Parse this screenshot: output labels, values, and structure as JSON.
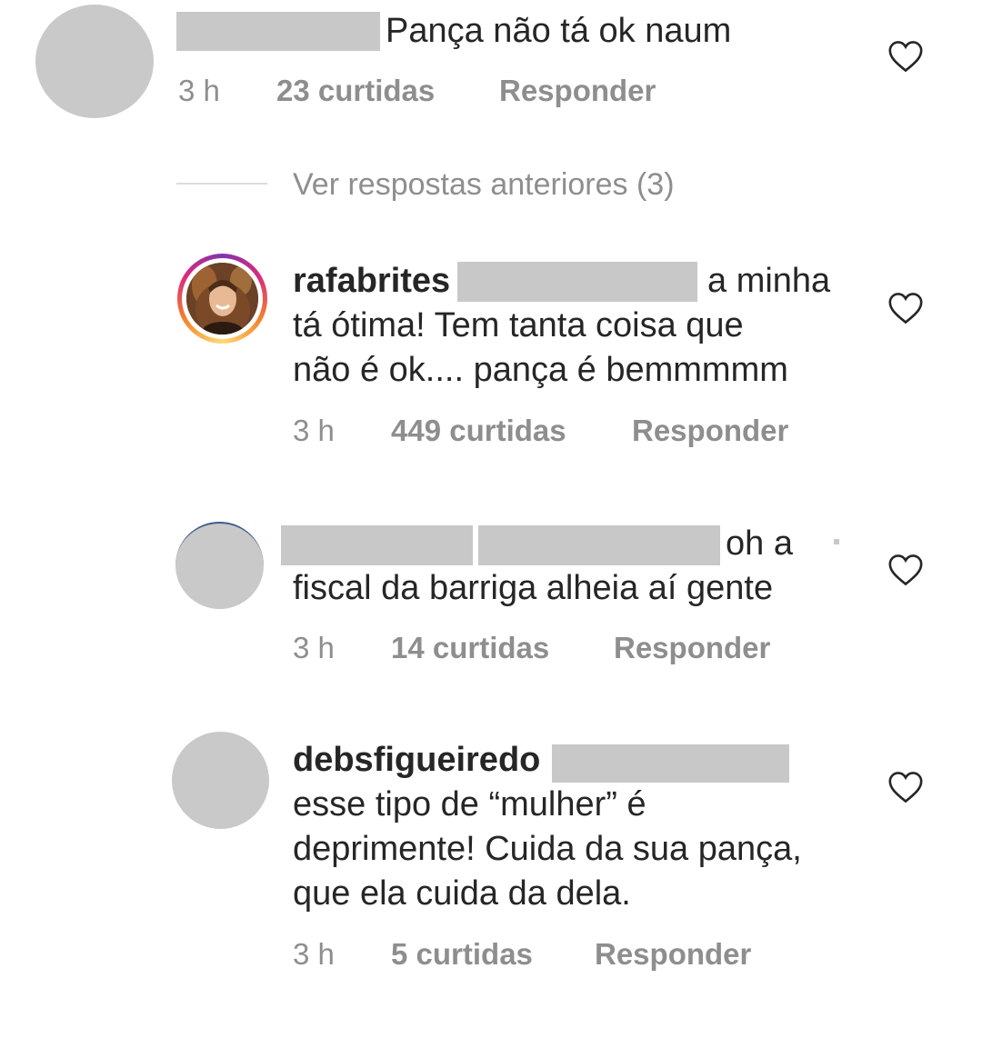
{
  "comments": [
    {
      "text": "Pança não tá ok naum",
      "time": "3 h",
      "likes": "23 curtidas",
      "reply": "Responder",
      "heart_icon": "heart-outline-icon"
    },
    {
      "username": "rafabrites",
      "text_line1": "a minha",
      "text_line2": "tá ótima! Tem tanta coisa que",
      "text_line3": "não é ok.... pança é bemmmmm",
      "time": "3 h",
      "likes": "449 curtidas",
      "reply": "Responder",
      "avatar_ring": [
        "#f58529",
        "#dd2a7b",
        "#8134af"
      ],
      "heart_icon": "heart-outline-icon"
    },
    {
      "text_line1": "oh a",
      "text_line2": "fiscal da barriga alheia aí gente",
      "time": "3 h",
      "likes": "14 curtidas",
      "reply": "Responder",
      "heart_icon": "heart-outline-icon"
    },
    {
      "username": "debsfigueiredo",
      "text_line1": "esse tipo de “mulher” é",
      "text_line2": "deprimente! Cuida da sua pança,",
      "text_line3": "que ela cuida da dela.",
      "time": "3 h",
      "likes": "5 curtidas",
      "reply": "Responder",
      "heart_icon": "heart-outline-icon"
    }
  ],
  "view_previous": "Ver respostas anteriores (3)",
  "colors": {
    "text": "#262626",
    "meta": "#8e8e8e",
    "redaction": "#c8c8c8",
    "avatar_placeholder": "#c9c9c9"
  }
}
